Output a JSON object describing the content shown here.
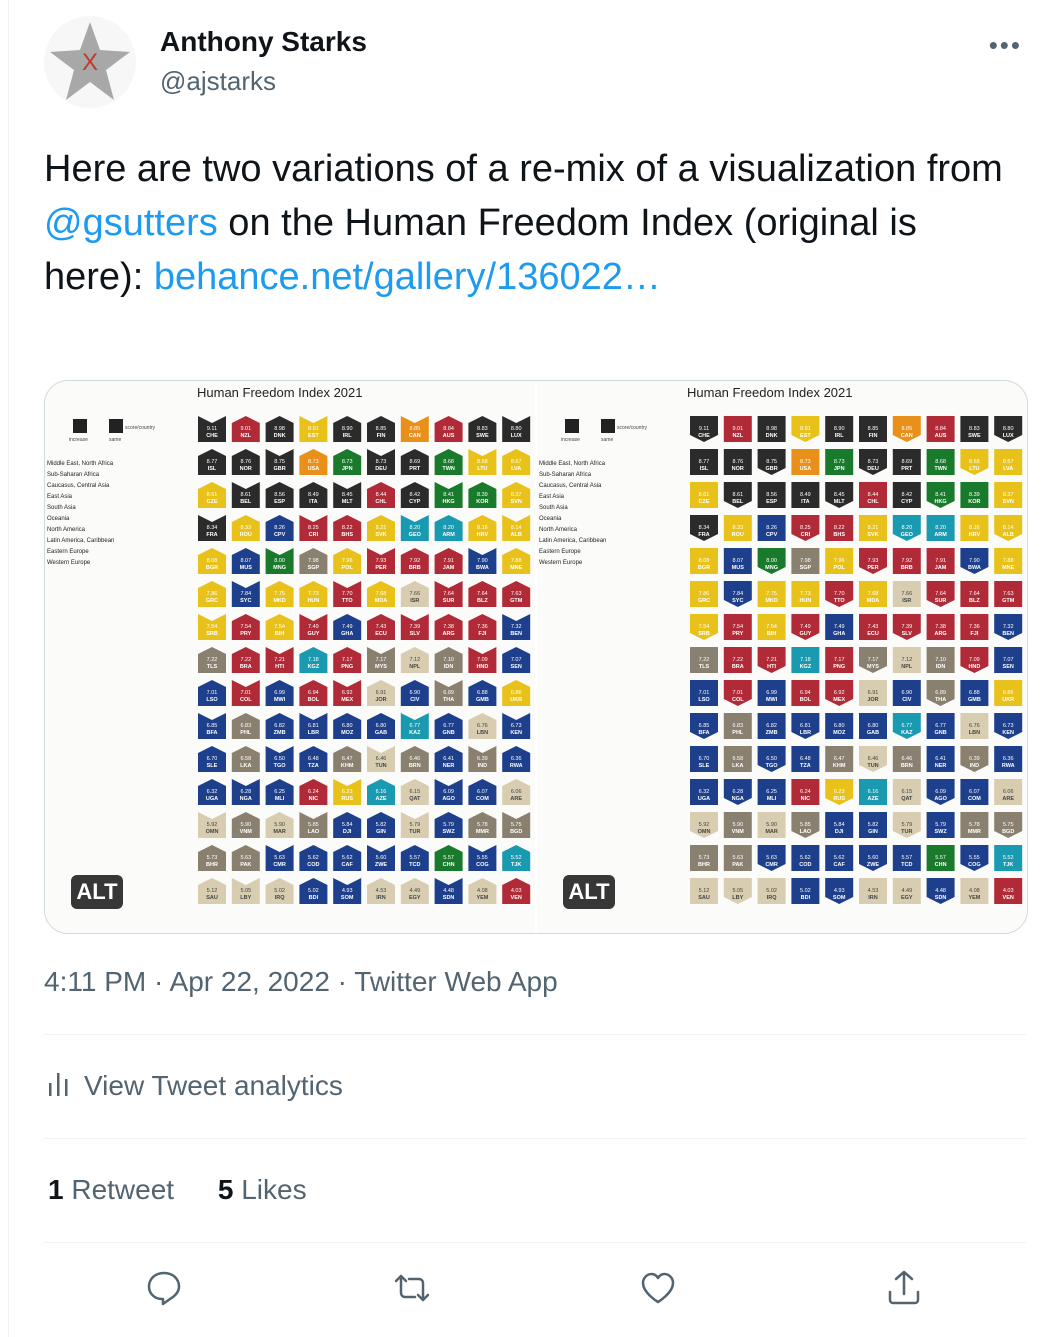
{
  "author": {
    "name": "Anthony Starks",
    "handle": "@ajstarks"
  },
  "more_label": "•••",
  "tweet": {
    "text_1": "Here are two variations of a re-mix of a visualization from ",
    "mention": "@gsutters",
    "text_2": " on the Human Freedom Index (original is here): ",
    "link": "behance.net/gallery/136022…"
  },
  "media": {
    "alt_label": "ALT",
    "chart_title": "Human Freedom Index 2021",
    "legend_keys": [
      "increase",
      "same",
      "score/country"
    ],
    "legend_regions": [
      "Middle East, North Africa",
      "Sub-Saharan Africa",
      "Caucasus, Central Asia",
      "East Asia",
      "South Asia",
      "Oceania",
      "North America",
      "Latin America, Caribbean",
      "Eastern Europe",
      "Western Europe"
    ],
    "colors": {
      "Western Europe": "#2b2b2b",
      "Eastern Europe": "#e8c21a",
      "Latin America, Caribbean": "#b02a37",
      "North America": "#e8901a",
      "Oceania": "#b02a37",
      "South Asia": "#d8cdb0",
      "East Asia": "#197a2c",
      "Caucasus, Central Asia": "#1a9ab0",
      "Sub-Saharan Africa": "#1d3f8c",
      "Middle East, North Africa": "#8a8070"
    }
  },
  "chart_data": {
    "type": "table",
    "title": "Human Freedom Index 2021",
    "columns": [
      "score",
      "country"
    ],
    "rows": [
      [
        "9.11",
        "CHE"
      ],
      [
        "9.01",
        "NZL"
      ],
      [
        "8.98",
        "DNK"
      ],
      [
        "8.91",
        "EST"
      ],
      [
        "8.90",
        "IRL"
      ],
      [
        "8.85",
        "FIN"
      ],
      [
        "8.85",
        "CAN"
      ],
      [
        "8.84",
        "AUS"
      ],
      [
        "8.83",
        "SWE"
      ],
      [
        "8.80",
        "LUX"
      ],
      [
        "8.77",
        "ISL"
      ],
      [
        "8.76",
        "NOR"
      ],
      [
        "8.75",
        "GBR"
      ],
      [
        "8.73",
        "USA"
      ],
      [
        "8.73",
        "JPN"
      ],
      [
        "8.73",
        "DEU"
      ],
      [
        "8.69",
        "PRT"
      ],
      [
        "8.68",
        "TWN"
      ],
      [
        "8.68",
        "LTU"
      ],
      [
        "8.67",
        "LVA"
      ],
      [
        "8.61",
        "CZE"
      ],
      [
        "8.61",
        "BEL"
      ],
      [
        "8.56",
        "ESP"
      ],
      [
        "8.49",
        "ITA"
      ],
      [
        "8.45",
        "MLT"
      ],
      [
        "8.44",
        "CHL"
      ],
      [
        "8.42",
        "CYP"
      ],
      [
        "8.41",
        "HKG"
      ],
      [
        "8.39",
        "KOR"
      ],
      [
        "8.37",
        "SVN"
      ],
      [
        "8.34",
        "FRA"
      ],
      [
        "8.33",
        "ROU"
      ],
      [
        "8.26",
        "CPV"
      ],
      [
        "8.25",
        "CRI"
      ],
      [
        "8.22",
        "BHS"
      ],
      [
        "8.21",
        "SVK"
      ],
      [
        "8.20",
        "GEO"
      ],
      [
        "8.20",
        "ARM"
      ],
      [
        "8.16",
        "HRV"
      ],
      [
        "8.14",
        "ALB"
      ],
      [
        "8.08",
        "BGR"
      ],
      [
        "8.07",
        "MUS"
      ],
      [
        "8.00",
        "MNG"
      ],
      [
        "7.98",
        "SGP"
      ],
      [
        "7.96",
        "POL"
      ],
      [
        "7.93",
        "PER"
      ],
      [
        "7.92",
        "BRB"
      ],
      [
        "7.91",
        "JAM"
      ],
      [
        "7.90",
        "BWA"
      ],
      [
        "7.88",
        "MNE"
      ],
      [
        "7.86",
        "GRC"
      ],
      [
        "7.84",
        "SYC"
      ],
      [
        "7.75",
        "MKD"
      ],
      [
        "7.73",
        "HUN"
      ],
      [
        "7.70",
        "TTO"
      ],
      [
        "7.68",
        "MDA"
      ],
      [
        "7.66",
        "ISR"
      ],
      [
        "7.64",
        "SUR"
      ],
      [
        "7.64",
        "BLZ"
      ],
      [
        "7.63",
        "GTM"
      ],
      [
        "7.54",
        "SRB"
      ],
      [
        "7.54",
        "PRY"
      ],
      [
        "7.54",
        "BIH"
      ],
      [
        "7.49",
        "GUY"
      ],
      [
        "7.49",
        "GHA"
      ],
      [
        "7.43",
        "ECU"
      ],
      [
        "7.39",
        "SLV"
      ],
      [
        "7.38",
        "ARG"
      ],
      [
        "7.36",
        "FJI"
      ],
      [
        "7.32",
        "BEN"
      ],
      [
        "7.22",
        "TLS"
      ],
      [
        "7.22",
        "BRA"
      ],
      [
        "7.21",
        "HTI"
      ],
      [
        "7.18",
        "KGZ"
      ],
      [
        "7.17",
        "PNG"
      ],
      [
        "7.17",
        "MYS"
      ],
      [
        "7.12",
        "NPL"
      ],
      [
        "7.10",
        "IDN"
      ],
      [
        "7.09",
        "HND"
      ],
      [
        "7.07",
        "SEN"
      ],
      [
        "7.01",
        "LSO"
      ],
      [
        "7.01",
        "COL"
      ],
      [
        "6.99",
        "MWI"
      ],
      [
        "6.94",
        "BOL"
      ],
      [
        "6.92",
        "MEX"
      ],
      [
        "6.91",
        "JOR"
      ],
      [
        "6.90",
        "CIV"
      ],
      [
        "6.89",
        "THA"
      ],
      [
        "6.88",
        "GMB"
      ],
      [
        "6.86",
        "UKR"
      ],
      [
        "6.85",
        "BFA"
      ],
      [
        "6.83",
        "PHL"
      ],
      [
        "6.82",
        "ZMB"
      ],
      [
        "6.81",
        "LBR"
      ],
      [
        "6.80",
        "MOZ"
      ],
      [
        "6.80",
        "GAB"
      ],
      [
        "6.77",
        "KAZ"
      ],
      [
        "6.77",
        "GNB"
      ],
      [
        "6.76",
        "LBN"
      ],
      [
        "6.73",
        "KEN"
      ],
      [
        "6.70",
        "SLE"
      ],
      [
        "6.58",
        "LKA"
      ],
      [
        "6.50",
        "TGO"
      ],
      [
        "6.48",
        "TZA"
      ],
      [
        "6.47",
        "KHM"
      ],
      [
        "6.46",
        "TUN"
      ],
      [
        "6.46",
        "BRN"
      ],
      [
        "6.41",
        "NER"
      ],
      [
        "6.39",
        "IND"
      ],
      [
        "6.36",
        "RWA"
      ],
      [
        "6.32",
        "UGA"
      ],
      [
        "6.28",
        "NGA"
      ],
      [
        "6.25",
        "MLI"
      ],
      [
        "6.24",
        "NIC"
      ],
      [
        "6.23",
        "RUS"
      ],
      [
        "6.16",
        "AZE"
      ],
      [
        "6.15",
        "QAT"
      ],
      [
        "6.09",
        "AGO"
      ],
      [
        "6.07",
        "COM"
      ],
      [
        "6.06",
        "ARE"
      ],
      [
        "5.92",
        "OMN"
      ],
      [
        "5.90",
        "VNM"
      ],
      [
        "5.90",
        "MAR"
      ],
      [
        "5.85",
        "LAO"
      ],
      [
        "5.84",
        "DJI"
      ],
      [
        "5.82",
        "GIN"
      ],
      [
        "5.79",
        "TUR"
      ],
      [
        "5.79",
        "SWZ"
      ],
      [
        "5.78",
        "MMR"
      ],
      [
        "5.75",
        "BGD"
      ],
      [
        "5.73",
        "BHR"
      ],
      [
        "5.63",
        "PAK"
      ],
      [
        "5.63",
        "CMR"
      ],
      [
        "5.62",
        "COD"
      ],
      [
        "5.62",
        "CAF"
      ],
      [
        "5.60",
        "ZWE"
      ],
      [
        "5.57",
        "TCD"
      ],
      [
        "5.57",
        "CHN"
      ],
      [
        "5.55",
        "COG"
      ],
      [
        "5.52",
        "TJK"
      ],
      [
        "5.12",
        "SAU"
      ],
      [
        "5.05",
        "LBY"
      ],
      [
        "5.02",
        "IRQ"
      ],
      [
        "5.02",
        "BDI"
      ],
      [
        "4.93",
        "SOM"
      ],
      [
        "4.53",
        "IRN"
      ],
      [
        "4.49",
        "EGY"
      ],
      [
        "4.48",
        "SDN"
      ],
      [
        "4.08",
        "YEM"
      ],
      [
        "4.03",
        "VEN"
      ]
    ],
    "region": [
      "Western Europe",
      "Oceania",
      "Western Europe",
      "Eastern Europe",
      "Western Europe",
      "Western Europe",
      "North America",
      "Oceania",
      "Western Europe",
      "Western Europe",
      "Western Europe",
      "Western Europe",
      "Western Europe",
      "North America",
      "East Asia",
      "Western Europe",
      "Western Europe",
      "East Asia",
      "Eastern Europe",
      "Eastern Europe",
      "Eastern Europe",
      "Western Europe",
      "Western Europe",
      "Western Europe",
      "Western Europe",
      "Latin America, Caribbean",
      "Western Europe",
      "East Asia",
      "East Asia",
      "Eastern Europe",
      "Western Europe",
      "Eastern Europe",
      "Sub-Saharan Africa",
      "Latin America, Caribbean",
      "Latin America, Caribbean",
      "Eastern Europe",
      "Caucasus, Central Asia",
      "Caucasus, Central Asia",
      "Eastern Europe",
      "Eastern Europe",
      "Eastern Europe",
      "Sub-Saharan Africa",
      "East Asia",
      "Middle East, North Africa",
      "Eastern Europe",
      "Latin America, Caribbean",
      "Latin America, Caribbean",
      "Latin America, Caribbean",
      "Sub-Saharan Africa",
      "Eastern Europe",
      "Eastern Europe",
      "Sub-Saharan Africa",
      "Eastern Europe",
      "Eastern Europe",
      "Latin America, Caribbean",
      "Eastern Europe",
      "South Asia",
      "Latin America, Caribbean",
      "Latin America, Caribbean",
      "Latin America, Caribbean",
      "Eastern Europe",
      "Latin America, Caribbean",
      "Eastern Europe",
      "Latin America, Caribbean",
      "Sub-Saharan Africa",
      "Latin America, Caribbean",
      "Latin America, Caribbean",
      "Latin America, Caribbean",
      "Oceania",
      "Sub-Saharan Africa",
      "Middle East, North Africa",
      "Latin America, Caribbean",
      "Latin America, Caribbean",
      "Caucasus, Central Asia",
      "Oceania",
      "Middle East, North Africa",
      "South Asia",
      "Middle East, North Africa",
      "Latin America, Caribbean",
      "Sub-Saharan Africa",
      "Sub-Saharan Africa",
      "Latin America, Caribbean",
      "Sub-Saharan Africa",
      "Latin America, Caribbean",
      "Latin America, Caribbean",
      "South Asia",
      "Sub-Saharan Africa",
      "Middle East, North Africa",
      "Sub-Saharan Africa",
      "Eastern Europe",
      "Sub-Saharan Africa",
      "Middle East, North Africa",
      "Sub-Saharan Africa",
      "Sub-Saharan Africa",
      "Sub-Saharan Africa",
      "Sub-Saharan Africa",
      "Caucasus, Central Asia",
      "Sub-Saharan Africa",
      "South Asia",
      "Sub-Saharan Africa",
      "Sub-Saharan Africa",
      "Middle East, North Africa",
      "Sub-Saharan Africa",
      "Sub-Saharan Africa",
      "Middle East, North Africa",
      "South Asia",
      "Middle East, North Africa",
      "Sub-Saharan Africa",
      "Middle East, North Africa",
      "Sub-Saharan Africa",
      "Sub-Saharan Africa",
      "Sub-Saharan Africa",
      "Sub-Saharan Africa",
      "Latin America, Caribbean",
      "Eastern Europe",
      "Caucasus, Central Asia",
      "South Asia",
      "Sub-Saharan Africa",
      "Sub-Saharan Africa",
      "South Asia",
      "South Asia",
      "Middle East, North Africa",
      "South Asia",
      "Middle East, North Africa",
      "Sub-Saharan Africa",
      "Sub-Saharan Africa",
      "South Asia",
      "Sub-Saharan Africa",
      "Middle East, North Africa",
      "Middle East, North Africa",
      "Middle East, North Africa",
      "Middle East, North Africa",
      "Sub-Saharan Africa",
      "Sub-Saharan Africa",
      "Sub-Saharan Africa",
      "Sub-Saharan Africa",
      "Sub-Saharan Africa",
      "East Asia",
      "Sub-Saharan Africa",
      "Caucasus, Central Asia",
      "South Asia",
      "South Asia",
      "South Asia",
      "Sub-Saharan Africa",
      "Sub-Saharan Africa",
      "South Asia",
      "South Asia",
      "Sub-Saharan Africa",
      "South Asia",
      "Latin America, Caribbean"
    ]
  },
  "meta": {
    "time": "4:11 PM",
    "date": "Apr 22, 2022",
    "source": "Twitter Web App",
    "sep": " · "
  },
  "analytics_label": "View Tweet analytics",
  "stats": {
    "retweets_count": "1",
    "retweets_label": "Retweet",
    "likes_count": "5",
    "likes_label": "Likes"
  }
}
